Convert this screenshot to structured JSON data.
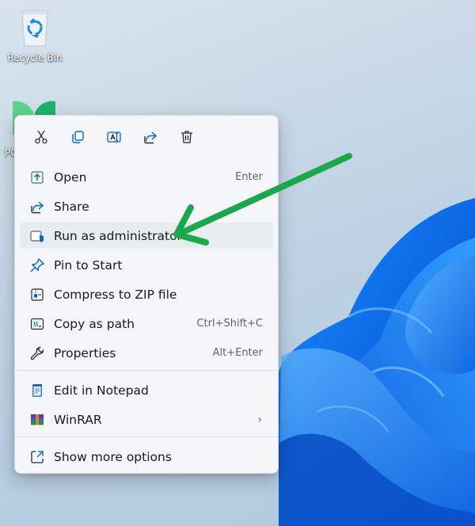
{
  "desktop": {
    "recycle_bin_label": "Recycle Bin",
    "pc_label": "PC"
  },
  "toolbar": {
    "buttons": [
      "cut-icon",
      "copy-icon",
      "rename-icon",
      "share-icon",
      "delete-icon"
    ]
  },
  "menu": {
    "items": [
      {
        "label": "Open",
        "shortcut": "Enter",
        "icon": "open-icon"
      },
      {
        "label": "Share",
        "shortcut": "",
        "icon": "share-icon"
      },
      {
        "label": "Run as administrator",
        "shortcut": "",
        "icon": "shield-icon"
      },
      {
        "label": "Pin to Start",
        "shortcut": "",
        "icon": "pin-icon"
      },
      {
        "label": "Compress to ZIP file",
        "shortcut": "",
        "icon": "zip-icon"
      },
      {
        "label": "Copy as path",
        "shortcut": "Ctrl+Shift+C",
        "icon": "copy-path-icon"
      },
      {
        "label": "Properties",
        "shortcut": "Alt+Enter",
        "icon": "wrench-icon"
      },
      {
        "label": "Edit in Notepad",
        "shortcut": "",
        "icon": "notepad-icon"
      },
      {
        "label": "WinRAR",
        "shortcut": "",
        "icon": "winrar-icon",
        "submenu_glyph": "›"
      },
      {
        "label": "Show more options",
        "shortcut": "",
        "icon": "show-more-icon"
      }
    ]
  },
  "colors": {
    "accent_blue": "#0067c0",
    "annotation_arrow": "#1aa84b",
    "menu_bg": "#f4f6f9"
  }
}
